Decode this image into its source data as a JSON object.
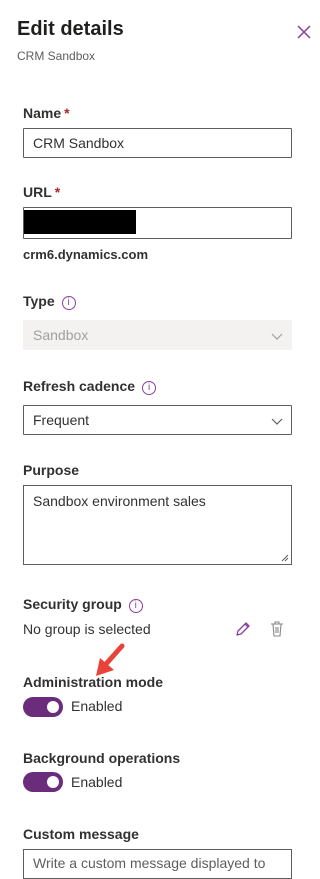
{
  "header": {
    "title": "Edit details",
    "subtitle": "CRM Sandbox"
  },
  "fields": {
    "name": {
      "label": "Name",
      "required_mark": "*",
      "value": "CRM Sandbox"
    },
    "url": {
      "label": "URL",
      "required_mark": "*",
      "domain_suffix": "crm6.dynamics.com"
    },
    "type": {
      "label": "Type",
      "value": "Sandbox",
      "info_icon": "i"
    },
    "refresh_cadence": {
      "label": "Refresh cadence",
      "value": "Frequent",
      "info_icon": "i"
    },
    "purpose": {
      "label": "Purpose",
      "value": "Sandbox environment sales"
    },
    "security_group": {
      "label": "Security group",
      "value": "No group is selected",
      "info_icon": "i"
    },
    "administration_mode": {
      "label": "Administration mode",
      "state": "Enabled"
    },
    "background_operations": {
      "label": "Background operations",
      "state": "Enabled"
    },
    "custom_message": {
      "label": "Custom message",
      "placeholder": "Write a custom message displayed to"
    }
  },
  "icons": {
    "close": "close-icon",
    "edit": "pencil-icon",
    "delete": "trash-icon",
    "chevron": "chevron-down-icon",
    "info": "info-icon"
  },
  "colors": {
    "accent": "#8a3f9e",
    "toggle_on": "#6b2d7b",
    "required": "#a4262c",
    "annotation_arrow": "#e8423a"
  }
}
